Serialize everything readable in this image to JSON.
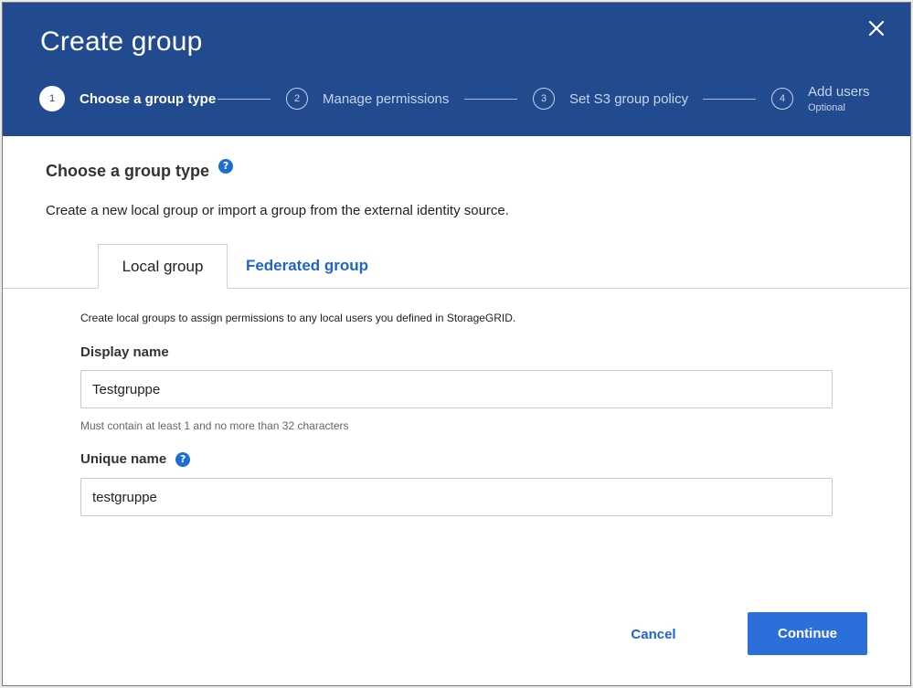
{
  "dialog": {
    "title": "Create group"
  },
  "stepper": {
    "steps": [
      {
        "number": "1",
        "label": "Choose a group type",
        "active": true
      },
      {
        "number": "2",
        "label": "Manage permissions"
      },
      {
        "number": "3",
        "label": "Set S3 group policy"
      },
      {
        "number": "4",
        "label": "Add users",
        "sublabel": "Optional"
      }
    ]
  },
  "section": {
    "title": "Choose a group type",
    "help_glyph": "?",
    "intro": "Create a new local group or import a group from the external identity source."
  },
  "tabs": {
    "local": "Local group",
    "federated": "Federated group"
  },
  "local_group": {
    "description": "Create local groups to assign permissions to any local users you defined in StorageGRID.",
    "display_name": {
      "label": "Display name",
      "value": "Testgruppe",
      "hint": "Must contain at least 1 and no more than 32 characters"
    },
    "unique_name": {
      "label": "Unique name",
      "help_glyph": "?",
      "value": "testgruppe"
    }
  },
  "footer": {
    "cancel_label": "Cancel",
    "continue_label": "Continue"
  },
  "colors": {
    "header_bg": "#224a8f",
    "primary": "#2c6fdb",
    "link": "#1f64c8"
  },
  "icons": {
    "close": "close-icon",
    "help": "help-icon"
  }
}
